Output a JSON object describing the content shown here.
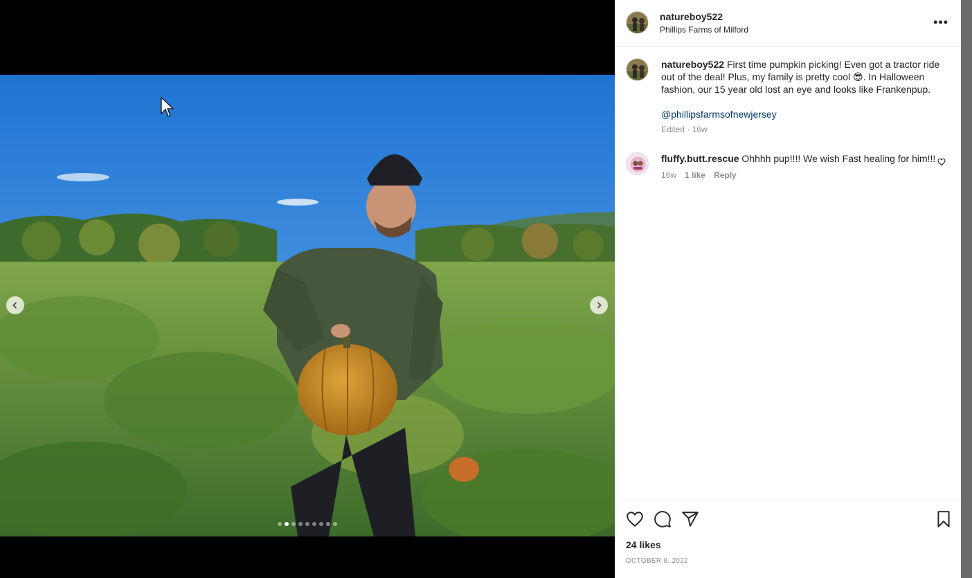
{
  "post": {
    "author": "natureboy522",
    "location": "Phillips Farms of Milford",
    "caption_text": "First time pumpkin picking! Even got a tractor ride out of the deal! Plus, my family is pretty cool 😎. In Halloween fashion, our 15 year old lost an eye and looks like Frankenpup.",
    "mention": "@phillipsfarmsofnewjersey",
    "edited_meta": "Edited · 16w",
    "likes": "24 likes",
    "date": "OCTOBER 8, 2022"
  },
  "carousel": {
    "slide_count": 9,
    "active_index": 1
  },
  "comments": [
    {
      "author": "fluffy.butt.rescue",
      "text": "Ohhhh pup!!!! We wish Fast healing for him!!!",
      "age": "16w",
      "likes": "1 like",
      "reply_label": "Reply"
    }
  ],
  "icons": {
    "more": "more-options-icon",
    "like": "heart-icon",
    "comment": "comment-icon",
    "share": "send-icon",
    "save": "bookmark-icon"
  },
  "colors": {
    "link": "#00376b",
    "muted": "#8e8e8e",
    "text": "#262626"
  }
}
